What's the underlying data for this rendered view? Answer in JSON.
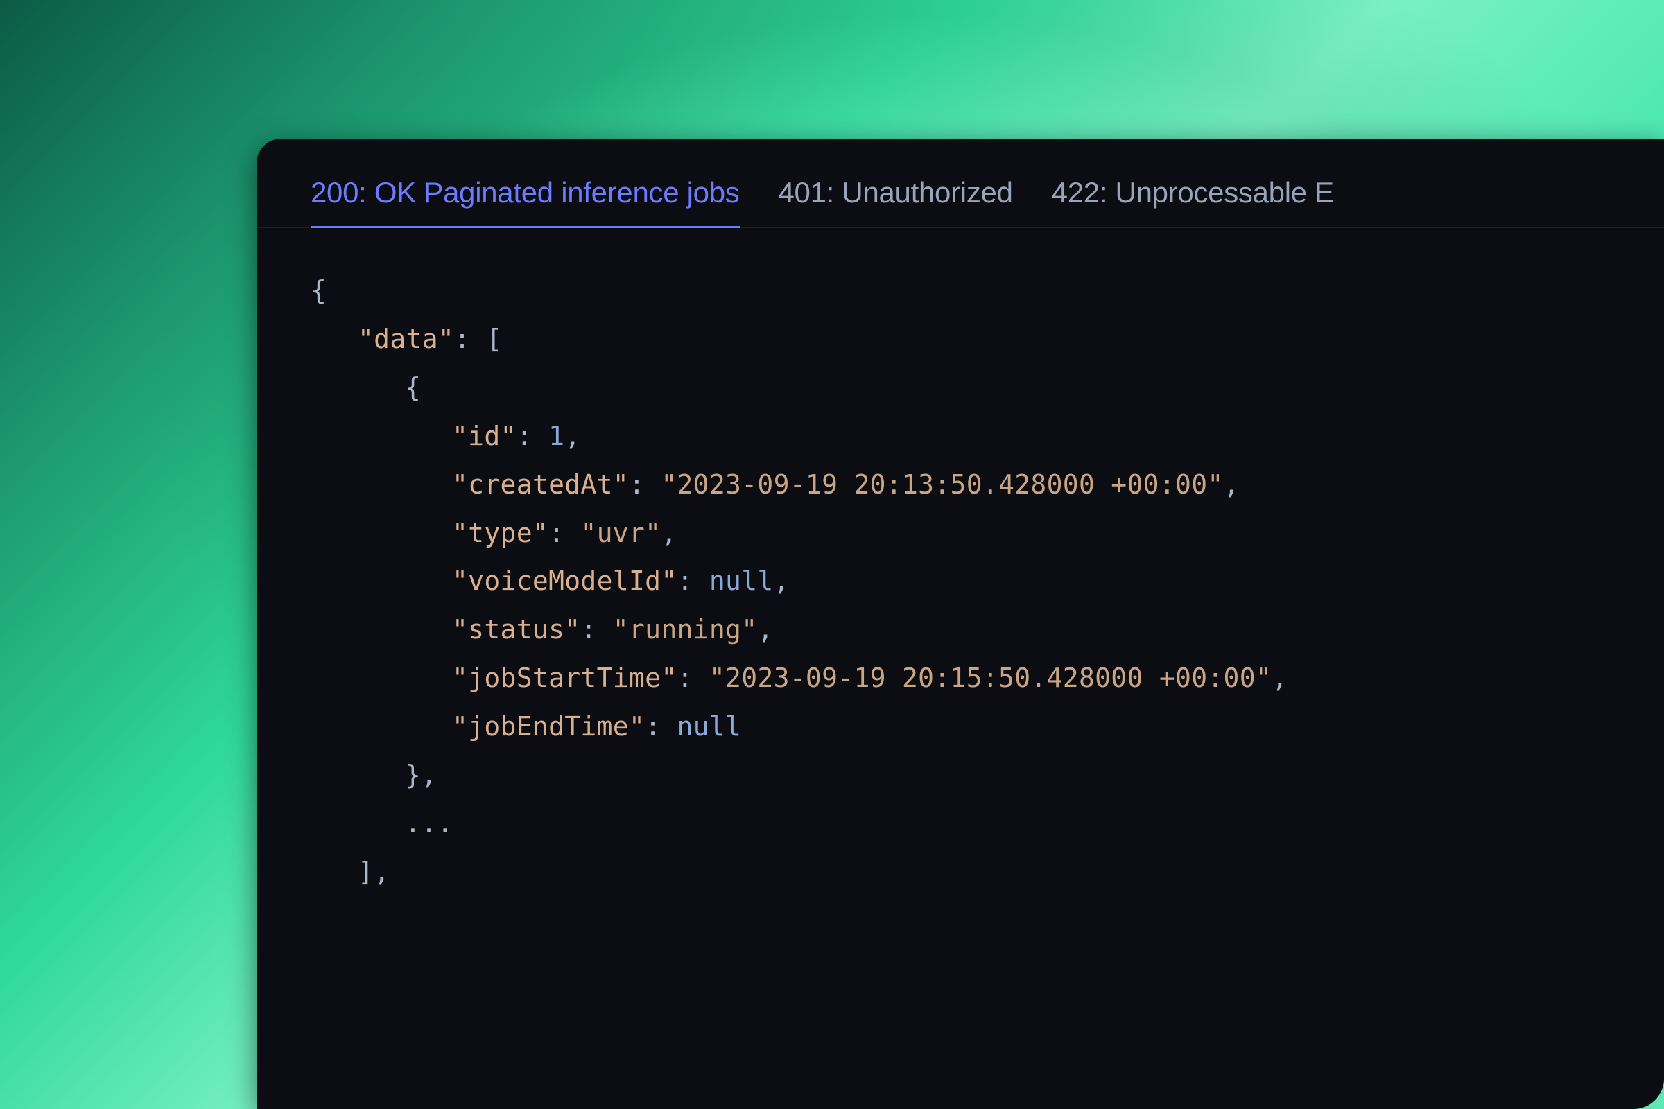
{
  "tabs": [
    {
      "label": "200: OK Paginated inference jobs",
      "active": true
    },
    {
      "label": "401: Unauthorized",
      "active": false
    },
    {
      "label": "422: Unprocessable E",
      "active": false
    }
  ],
  "code": {
    "open_brace": "{",
    "data_key": "\"data\"",
    "colon_space": ": ",
    "open_bracket": "[",
    "item_open": "{",
    "id_key": "\"id\"",
    "id_val": "1",
    "createdAt_key": "\"createdAt\"",
    "createdAt_val": "\"2023-09-19 20:13:50.428000 +00:00\"",
    "type_key": "\"type\"",
    "type_val": "\"uvr\"",
    "voiceModelId_key": "\"voiceModelId\"",
    "voiceModelId_val": "null",
    "status_key": "\"status\"",
    "status_val": "\"running\"",
    "jobStartTime_key": "\"jobStartTime\"",
    "jobStartTime_val": "\"2023-09-19 20:15:50.428000 +00:00\"",
    "jobEndTime_key": "\"jobEndTime\"",
    "jobEndTime_val": "null",
    "item_close": "},",
    "ellipsis": "...",
    "close_bracket": "],",
    "comma": ","
  }
}
